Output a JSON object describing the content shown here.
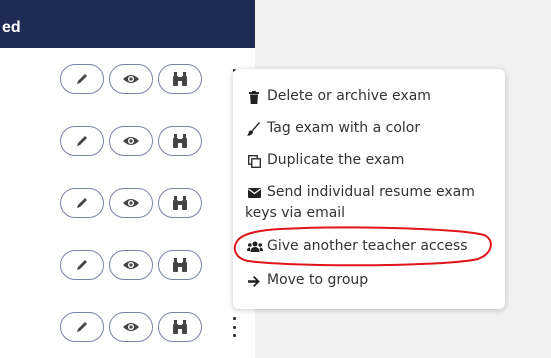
{
  "table": {
    "header_label": "ed",
    "row_count": 5
  },
  "context_menu": {
    "items": [
      {
        "label": "Delete or archive exam",
        "icon": "trash-icon"
      },
      {
        "label": "Tag exam with a color",
        "icon": "paintbrush-icon"
      },
      {
        "label": "Duplicate the exam",
        "icon": "copy-icon"
      },
      {
        "label": "Send individual resume exam",
        "label_line2": "keys via email",
        "icon": "envelope-icon"
      },
      {
        "label": "Give another teacher access",
        "icon": "users-icon"
      },
      {
        "label": "Move to group",
        "icon": "arrow-right-icon"
      }
    ]
  },
  "colors": {
    "header_bg": "#1f2a55",
    "button_border": "#7b83a7",
    "annotation_red": "#e0141b"
  }
}
